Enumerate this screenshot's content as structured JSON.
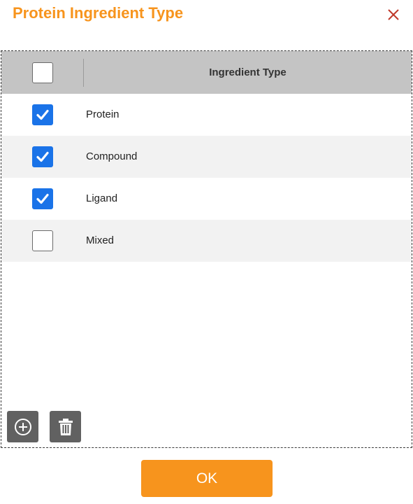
{
  "dialog": {
    "title": "Protein Ingredient Type",
    "close_icon": "close-icon",
    "ok_label": "OK"
  },
  "table": {
    "header": {
      "select_all_checked": false,
      "column_label": "Ingredient Type"
    },
    "rows": [
      {
        "label": "Protein",
        "checked": true
      },
      {
        "label": "Compound",
        "checked": true
      },
      {
        "label": "Ligand",
        "checked": true
      },
      {
        "label": "Mixed",
        "checked": false
      }
    ]
  },
  "toolbar": {
    "add_icon": "add-circle-icon",
    "delete_icon": "trash-icon"
  },
  "colors": {
    "accent": "#f7941d",
    "checkbox_checked": "#1a73e8",
    "close": "#c0392b",
    "tool_button": "#616161",
    "header_bg": "#c4c4c4",
    "alt_row_bg": "#f2f2f2"
  }
}
